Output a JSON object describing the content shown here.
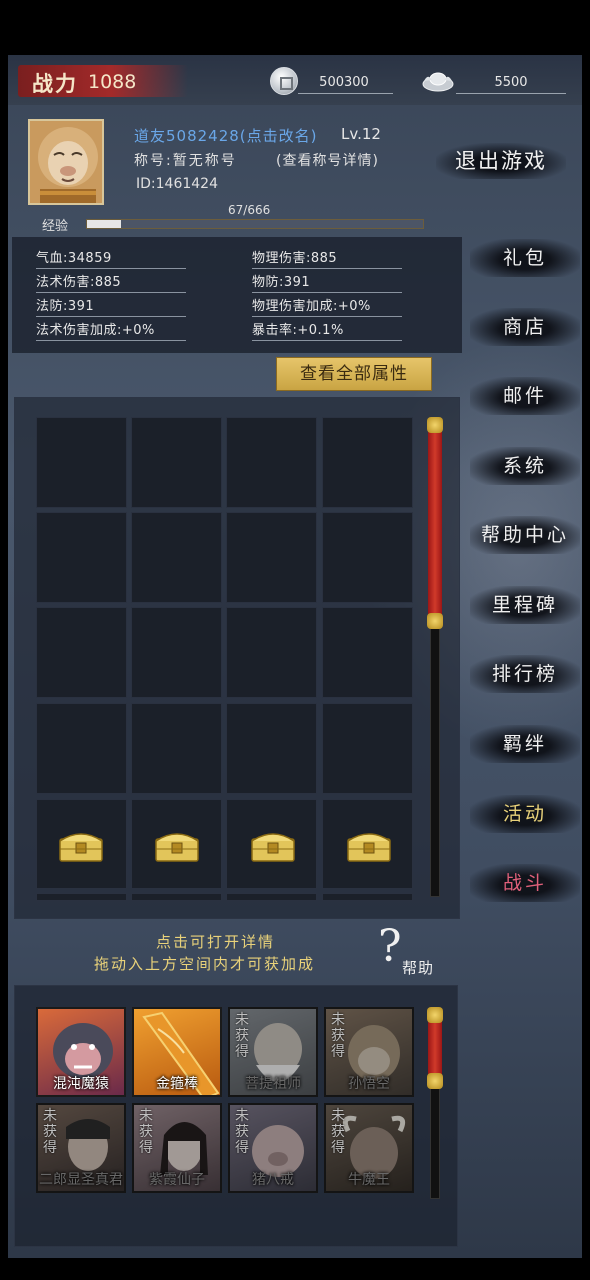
{
  "topbar": {
    "power_label": "战力",
    "power_value": "1088",
    "coin_value": "500300",
    "ingot_value": "5500"
  },
  "profile": {
    "name": "道友5082428(点击改名)",
    "level": "Lv.12",
    "title": "称号:暂无称号",
    "title_detail": "(查看称号详情)",
    "id": "ID:1461424",
    "exp_label": "经验",
    "exp_value": "67/666",
    "exp_fraction": 0.1
  },
  "exit_label": "退出游戏",
  "stats": {
    "hp": "气血:34859",
    "magic_dmg": "法术伤害:885",
    "magic_def": "法防:391",
    "magic_dmg_bonus": "法术伤害加成:+0%",
    "phys_dmg": "物理伤害:885",
    "phys_def": "物防:391",
    "phys_dmg_bonus": "物理伤害加成:+0%",
    "crit": "暴击率:+0.1%"
  },
  "view_all_label": "查看全部属性",
  "side_menu": [
    "礼包",
    "商店",
    "邮件",
    "系统",
    "帮助中心",
    "里程碑",
    "排行榜",
    "羁绊",
    "活动",
    "战斗"
  ],
  "hints": {
    "line1": "点击可打开详情",
    "line2": "拖动入上方空间内才可获加成",
    "help_mark": "?",
    "help_label": "帮助"
  },
  "cards": [
    {
      "name": "混沌魔猿",
      "obtained": true
    },
    {
      "name": "金箍棒",
      "obtained": true
    },
    {
      "name": "菩提祖师",
      "obtained": false
    },
    {
      "name": "孙悟空",
      "obtained": false
    },
    {
      "name": "二郎显圣真君",
      "obtained": false
    },
    {
      "name": "紫霞仙子",
      "obtained": false
    },
    {
      "name": "猪八戒",
      "obtained": false
    },
    {
      "name": "牛魔王",
      "obtained": false
    }
  ],
  "not_obtained_label": "未获得",
  "colors": {
    "power_red": "#a32a2a",
    "gold_text": "#e9d27a",
    "name_blue": "#6aa7e8",
    "battle_red": "#e0607a"
  }
}
